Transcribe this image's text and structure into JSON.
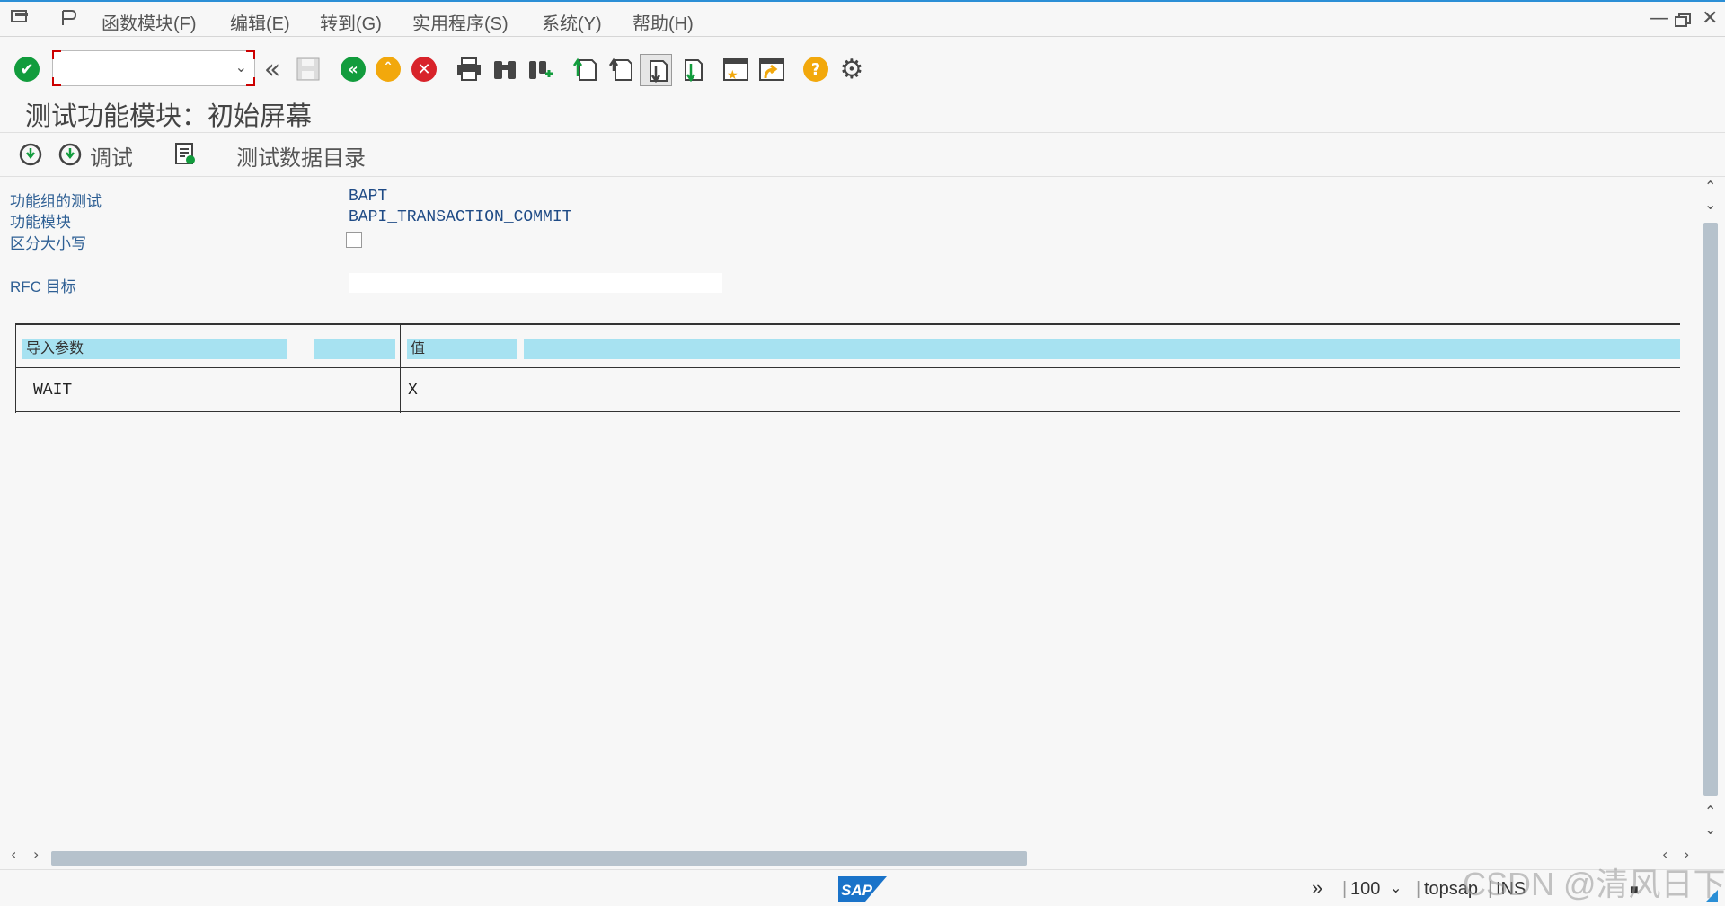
{
  "menubar": {
    "items": [
      "函数模块(F)",
      "编辑(E)",
      "转到(G)",
      "实用程序(S)",
      "系统(Y)",
      "帮助(H)"
    ]
  },
  "toolbar": {
    "command_field_value": "",
    "icons": [
      "enter-icon",
      "back-icon",
      "save-icon",
      "back-green-icon",
      "exit-icon",
      "cancel-icon",
      "print-icon",
      "find-icon",
      "find-next-icon",
      "first-page-icon",
      "prev-page-icon",
      "next-page-icon",
      "last-page-icon",
      "create-session-icon",
      "shortcut-icon",
      "help-icon",
      "settings-icon"
    ]
  },
  "title": "测试功能模块：初始屏幕",
  "app_toolbar": {
    "execute_label": "",
    "debug_label": "调试",
    "test_data_label": "测试数据目录"
  },
  "fields": {
    "function_group_label": "功能组的测试",
    "function_group_value": "BAPT",
    "function_module_label": "功能模块",
    "function_module_value": "BAPI_TRANSACTION_COMMIT",
    "case_sensitive_label": "区分大小写",
    "case_sensitive_checked": false,
    "rfc_label": "RFC 目标",
    "rfc_value": ""
  },
  "table": {
    "header_param": "导入参数",
    "header_value": "值",
    "rows": [
      {
        "param": "WAIT",
        "value": "X"
      }
    ]
  },
  "statusbar": {
    "zoom": "100",
    "system": "topsap",
    "mode": "INS"
  },
  "watermark": "CSDN @清风日下",
  "colors": {
    "accent": "#2b8fd6",
    "header_cell": "#a7e2f1",
    "label_blue": "#2e5f94"
  }
}
